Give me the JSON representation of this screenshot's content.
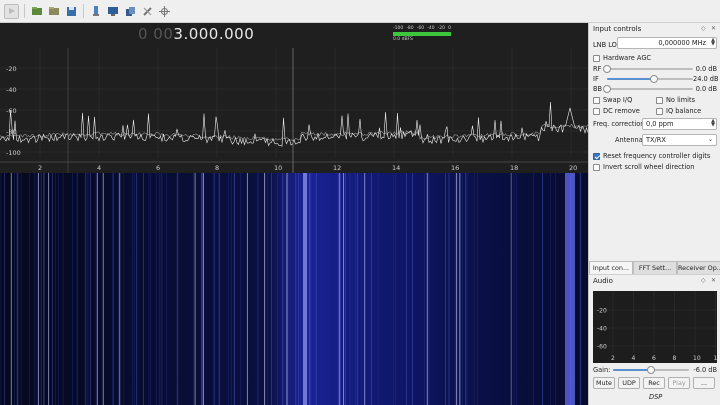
{
  "toolbar": {
    "buttons": [
      "start-dsp-icon",
      "open-file-icon",
      "open-folder-icon",
      "save-icon",
      "device-config-icon",
      "remote-control-icon",
      "copy-icon",
      "tools-icon",
      "crosshair-icon"
    ]
  },
  "display": {
    "frequency_dim": "0 00",
    "frequency_lit": "3.000.000",
    "signal_meter": {
      "ticks": [
        "-100",
        "-80",
        "-60",
        "-40",
        "-20",
        "0"
      ],
      "label": "0.0 dBFS",
      "level_fraction": 1.0
    }
  },
  "spectrum": {
    "y_ticks": [
      "-20",
      "-40",
      "-60",
      "-80",
      "-100"
    ],
    "x_ticks": [
      "2",
      "4",
      "6",
      "8",
      "10",
      "12",
      "14",
      "16",
      "18",
      "20"
    ],
    "colors": {
      "background": "#1f1f1f",
      "trace": "#f0f0f0",
      "grid": "#3a3a3a"
    }
  },
  "input_controls": {
    "title": "Input controls",
    "lnb_lo_label": "LNB LO",
    "lnb_lo_value": "0,000000 MHz",
    "hardware_agc": "Hardware AGC",
    "rf_label": "RF",
    "rf_value": "0.0 dB",
    "rf_level": 0.0,
    "if_label": "IF",
    "if_value": "24.0 dB",
    "if_level": 0.55,
    "bb_label": "BB",
    "bb_value": "0.0 dB",
    "bb_level": 0.0,
    "swap_iq": "Swap I/Q",
    "no_limits": "No limits",
    "dc_remove": "DC remove",
    "iq_balance": "IQ balance",
    "freq_correction_label": "Freq. correction",
    "freq_correction_value": "0,0 ppm",
    "antenna_label": "Antenna",
    "antenna_value": "TX/RX",
    "reset_freq": "Reset frequency controller digits",
    "invert_scroll": "Invert scroll wheel direction"
  },
  "tabs": [
    "Input con...",
    "FFT Sett...",
    "Receiver Op..."
  ],
  "audio": {
    "title": "Audio",
    "y_ticks": [
      "-20",
      "-40",
      "-60"
    ],
    "x_ticks": [
      "2",
      "4",
      "6",
      "8",
      "10",
      "1"
    ],
    "gain_label": "Gain:",
    "gain_value": "-6.0 dB",
    "gain_level": 0.5,
    "buttons": {
      "mute": "Mute",
      "udp": "UDP",
      "rec": "Rec",
      "play": "Play",
      "more": "..."
    },
    "footer": "DSP"
  }
}
